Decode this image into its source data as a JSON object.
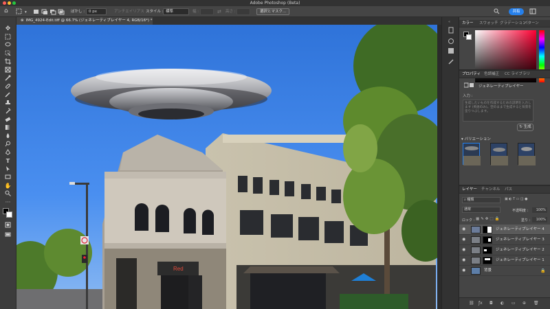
{
  "app": {
    "title": "Adobe Photoshop (Beta)"
  },
  "options_bar": {
    "feather_label": "ぼかし :",
    "feather_value": "0 px",
    "antialias_label": "アンチエイリアス",
    "style_label": "スタイル :",
    "style_value": "標準",
    "width_label": "幅 :",
    "height_label": "高さ :",
    "select_mask_label": "選択とマスク...",
    "share_label": "共有"
  },
  "document": {
    "tab_title": "IMG_4924-Edit.tiff @ 66.7% (ジェネレーティブレイヤー 4, RGB/16*) *"
  },
  "color_panel": {
    "tabs": [
      "カラー",
      "スウォッチ",
      "グラデーション",
      "パターン"
    ]
  },
  "properties_panel": {
    "tabs": [
      "プロパティ",
      "色調補正",
      "CC ライブラリ"
    ],
    "layer_kind_label": "ジェネレーティブレイヤー",
    "input_label": "入力 :",
    "prompt_placeholder": "生成したいものを作成するための説明を入力します (英語のみ)。空のままで生成すると背景を塗りつぶします。",
    "generate_label": "生成",
    "variations_label": "バリエーション"
  },
  "layers_panel": {
    "tabs": [
      "レイヤー",
      "チャンネル",
      "パス"
    ],
    "kind_filter": "種類",
    "blend_mode": "通常",
    "opacity_label": "不透明度 :",
    "opacity_value": "100%",
    "lock_label": "ロック :",
    "fill_label": "塗り :",
    "fill_value": "100%",
    "layers": [
      {
        "name": "ジェネレーティブレイヤー 4",
        "selected": true
      },
      {
        "name": "ジェネレーティブレイヤー 3",
        "selected": false
      },
      {
        "name": "ジェネレーティブレイヤー 2",
        "selected": false
      },
      {
        "name": "ジェネレーティブレイヤー 1",
        "selected": false
      },
      {
        "name": "背景",
        "selected": false
      }
    ]
  },
  "scene": {
    "shop_sign": "Red",
    "no_turn_sign": "NO TURN"
  },
  "colors": {
    "accent": "#2680eb",
    "sky": "#3f86e6",
    "panel_bg": "#454545",
    "selected_layer": "#5a5a5a"
  }
}
